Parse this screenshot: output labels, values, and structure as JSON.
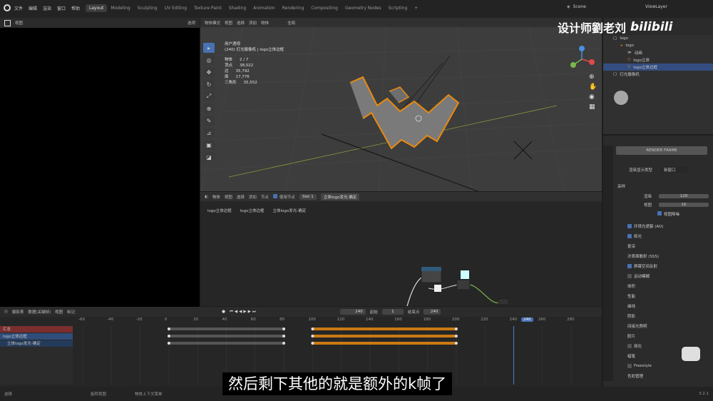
{
  "topbar": {
    "menus": [
      "文件",
      "编辑",
      "渲染",
      "窗口",
      "帮助"
    ],
    "workspaces": [
      "Layout",
      "Modeling",
      "Sculpting",
      "UV Editing",
      "Texture Paint",
      "Shading",
      "Animation",
      "Rendering",
      "Compositing",
      "Geometry Nodes",
      "Scripting"
    ],
    "active_ws": "Layout",
    "plus": "+",
    "scene": "Scene",
    "view_layer": "ViewLayer"
  },
  "watermark": {
    "text": "设计师劉老刘",
    "logo": "bilibili"
  },
  "left_editor": {
    "header_mode": "视图",
    "header_btn": "选项"
  },
  "viewport": {
    "mode": "物体模式",
    "menus": [
      "视图",
      "选择",
      "添加",
      "物体"
    ],
    "transform": "全局",
    "perspective": "用户透视",
    "camera_info": "(240) 灯光摄像机 | logo立体边框",
    "stats": [
      {
        "k": "物体",
        "v": "2 / 7"
      },
      {
        "k": "顶点",
        "v": "38,022"
      },
      {
        "k": "边",
        "v": "35,792"
      },
      {
        "k": "面",
        "v": "17,776"
      },
      {
        "k": "三角形",
        "v": "35,552"
      }
    ]
  },
  "node_editor": {
    "type": "物体",
    "menus": [
      "视图",
      "选择",
      "添加",
      "节点"
    ],
    "use_nodes": "使用节点",
    "slot": "Slot 1",
    "material": "立体logo发光-确定",
    "breadcrumb": [
      "logo立体边框",
      "logo立体边框",
      "立体logo发光-确定"
    ]
  },
  "outliner": {
    "items": [
      {
        "label": "logo",
        "depth": 1
      },
      {
        "label": "logo",
        "depth": 2
      },
      {
        "label": "动画",
        "depth": 3
      },
      {
        "label": "logo立体",
        "depth": 3
      },
      {
        "label": "logo立体边框",
        "depth": 3
      },
      {
        "label": "灯光摄像机",
        "depth": 1
      }
    ]
  },
  "properties": {
    "render_btn": "RENDER FRAME",
    "display_label": "渲染显示类型",
    "display_val": "新窗口",
    "sampling": "采样",
    "render_label": "渲染",
    "render_val": "128",
    "viewport_label": "视图",
    "viewport_val": "16",
    "denoise": "视图降噪",
    "sections": [
      {
        "label": "环境光遮蔽 (AO)",
        "check": "on"
      },
      {
        "label": "辉光",
        "check": "on"
      },
      {
        "label": "景深",
        "check": "none"
      },
      {
        "label": "次表面散射 (SSS)",
        "check": "none"
      },
      {
        "label": "屏幕空间反射",
        "check": "on"
      },
      {
        "label": "运动模糊",
        "check": "off"
      },
      {
        "label": "体积",
        "check": "none"
      },
      {
        "label": "性能",
        "check": "none"
      },
      {
        "label": "曲线",
        "check": "none"
      },
      {
        "label": "阴影",
        "check": "none"
      },
      {
        "label": "间接光照明",
        "check": "none"
      },
      {
        "label": "胶片",
        "check": "none"
      },
      {
        "label": "简化",
        "check": "off"
      },
      {
        "label": "蜡笔",
        "check": "none"
      },
      {
        "label": "Freestyle",
        "check": "off"
      },
      {
        "label": "色彩管理",
        "check": "none"
      }
    ]
  },
  "timeline": {
    "mode": "摄影表",
    "sub": "数据(关键帧)",
    "menus": [
      "视图",
      "标记"
    ],
    "frame": "240",
    "start_label": "起始",
    "start_val": "1",
    "end_label": "结束点",
    "end_val": "240",
    "ticks": [
      "-60",
      "-40",
      "-20",
      "0",
      "20",
      "40",
      "60",
      "80",
      "100",
      "120",
      "140",
      "160",
      "180",
      "200",
      "220",
      "240",
      "260",
      "280"
    ],
    "current": "240",
    "channels": [
      "汇总",
      "logo立体边框",
      "立体logo发光-确定"
    ]
  },
  "status": {
    "left": "选择",
    "mid": "旋转视图",
    "right": "物体上下文菜单",
    "version": "3.2.1"
  },
  "subtitle": "然后剩下其他的就是额外的k帧了",
  "colors": {
    "accent": "#4772b3",
    "orange": "#e88a10",
    "bg": "#1d1d1d"
  }
}
